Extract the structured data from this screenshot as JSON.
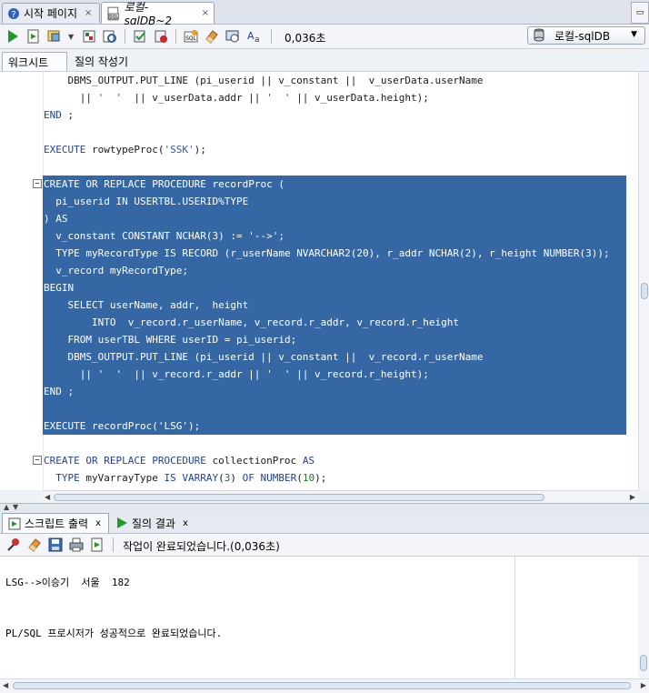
{
  "doc_tabs": [
    {
      "label": "시작 페이지",
      "close": "×"
    },
    {
      "label": "로컬-sqlDB~2",
      "close": "×"
    }
  ],
  "toolbar": {
    "elapsed": "0,036초",
    "connection": "로컬-sqlDB"
  },
  "subtabs": [
    {
      "label": "워크시트"
    },
    {
      "label": "질의 작성기"
    }
  ],
  "code_lines": [
    {
      "text": "    DBMS_OUTPUT.PUT_LINE (pi_userid || v_constant ||  v_userData.userName",
      "selected": false
    },
    {
      "text": "      || '  '  || v_userData.addr || '  ' || v_userData.height);",
      "selected": false
    },
    {
      "text": "END ;",
      "selected": false
    },
    {
      "text": "",
      "selected": false
    },
    {
      "text": "EXECUTE rowtypeProc('SSK');",
      "selected": false
    },
    {
      "text": "",
      "selected": false
    },
    {
      "text": "CREATE OR REPLACE PROCEDURE recordProc (",
      "selected": true,
      "fold": "−"
    },
    {
      "text": "  pi_userid IN USERTBL.USERID%TYPE",
      "selected": true
    },
    {
      "text": ") AS",
      "selected": true
    },
    {
      "text": "  v_constant CONSTANT NCHAR(3) := '-->';",
      "selected": true
    },
    {
      "text": "  TYPE myRecordType IS RECORD (r_userName NVARCHAR2(20), r_addr NCHAR(2), r_height NUMBER(3));",
      "selected": true
    },
    {
      "text": "  v_record myRecordType;",
      "selected": true
    },
    {
      "text": "BEGIN",
      "selected": true
    },
    {
      "text": "    SELECT userName, addr,  height",
      "selected": true
    },
    {
      "text": "        INTO  v_record.r_userName, v_record.r_addr, v_record.r_height",
      "selected": true
    },
    {
      "text": "    FROM userTBL WHERE userID = pi_userid;",
      "selected": true
    },
    {
      "text": "    DBMS_OUTPUT.PUT_LINE (pi_userid || v_constant ||  v_record.r_userName",
      "selected": true
    },
    {
      "text": "      || '  '  || v_record.r_addr || '  ' || v_record.r_height);",
      "selected": true
    },
    {
      "text": "END ;",
      "selected": true
    },
    {
      "text": "",
      "selected": true
    },
    {
      "text": "EXECUTE recordProc('LSG');",
      "selected": true
    },
    {
      "text": "",
      "selected": false
    },
    {
      "text": "CREATE OR REPLACE PROCEDURE collectionProc AS",
      "selected": false,
      "fold": "−"
    },
    {
      "text": "  TYPE myVarrayType IS VARRAY(3) OF NUMBER(10);",
      "selected": false
    }
  ],
  "output_tabs": [
    {
      "label": "스크립트 출력",
      "close": "x"
    },
    {
      "label": "질의 결과",
      "close": "x"
    }
  ],
  "output_status": "작업이 완료되었습니다.(0,036초)",
  "output_lines": [
    "LSG-->이승기  서울  182",
    "PL/SQL 프로시저가 성공적으로 완료되었습니다."
  ]
}
